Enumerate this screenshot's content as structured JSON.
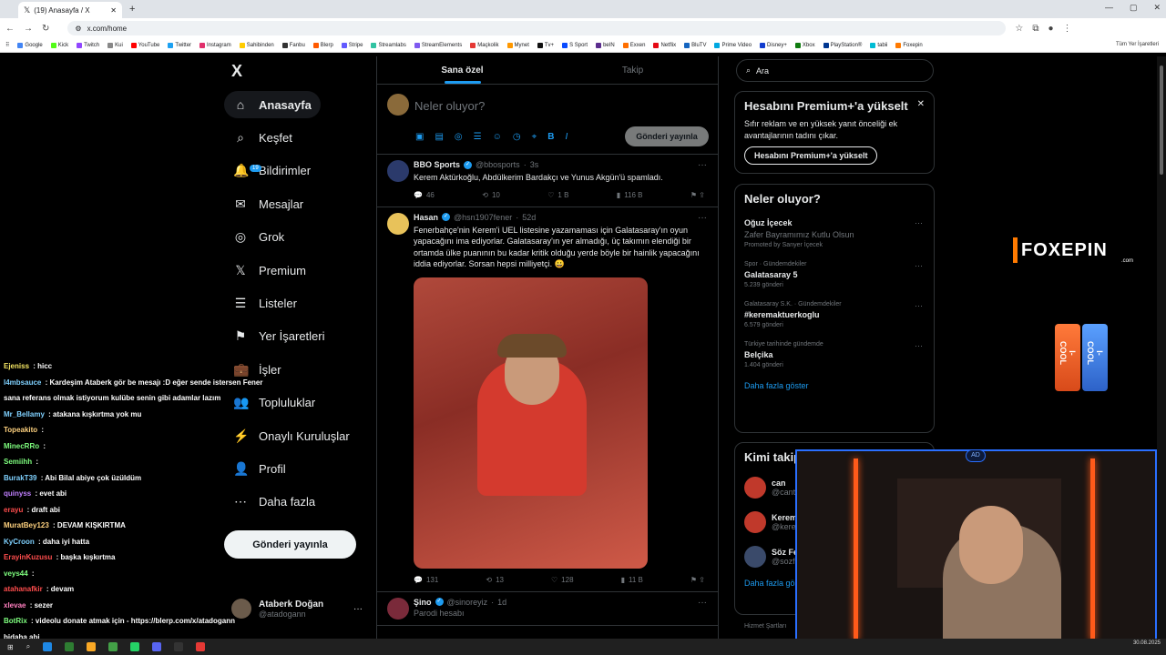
{
  "browser": {
    "tab_title": "(19) Anasayfa / X",
    "url": "x.com/home",
    "all_bookmarks": "Tüm Yer İşaretleri",
    "bookmarks": [
      "Google",
      "Kick",
      "Twitch",
      "Kui",
      "YouTube",
      "Twitter",
      "Instagram",
      "Sahibinden",
      "Fanbu",
      "Blerp",
      "Stripe",
      "Streamlabs",
      "StreamElements",
      "Maçkolik",
      "Mynet",
      "Tv+",
      "S Sport",
      "beIN",
      "Exxen",
      "Netflix",
      "BluTV",
      "Prime Video",
      "Disney+",
      "Xbox",
      "PlayStation®",
      "tabii",
      "Foxepin"
    ]
  },
  "nav": {
    "logo": "X",
    "items": [
      {
        "label": "Anasayfa",
        "icon": "home-icon"
      },
      {
        "label": "Keşfet",
        "icon": "search-icon"
      },
      {
        "label": "Bildirimler",
        "icon": "bell-icon",
        "badge": "19"
      },
      {
        "label": "Mesajlar",
        "icon": "mail-icon"
      },
      {
        "label": "Grok",
        "icon": "grok-icon"
      },
      {
        "label": "Premium",
        "icon": "x-premium-icon"
      },
      {
        "label": "Listeler",
        "icon": "list-icon"
      },
      {
        "label": "Yer İşaretleri",
        "icon": "bookmark-icon"
      },
      {
        "label": "İşler",
        "icon": "briefcase-icon"
      },
      {
        "label": "Topluluklar",
        "icon": "communities-icon"
      },
      {
        "label": "Onaylı Kuruluşlar",
        "icon": "lightning-icon"
      },
      {
        "label": "Profil",
        "icon": "profile-icon"
      },
      {
        "label": "Daha fazla",
        "icon": "more-circle-icon"
      }
    ],
    "post_button": "Gönderi yayınla",
    "account_name": "Ataberk Doğan",
    "account_handle": "@atadogann"
  },
  "timeline": {
    "tabs": [
      "Sana özel",
      "Takip"
    ],
    "compose_placeholder": "Neler oluyor?",
    "compose_button": "Gönderi yayınla",
    "tweets": [
      {
        "name": "BBO Sports",
        "handle": "@bbosports",
        "time": "3s",
        "text": "Kerem Aktürkoğlu, Abdülkerim Bardakçı ve Yunus Akgün'ü spamladı.",
        "replies": "46",
        "reposts": "10",
        "likes": "1 B",
        "views": "116 B"
      },
      {
        "name": "Hasan",
        "handle": "@hsn1907fener",
        "time": "52d",
        "text": "Fenerbahçe'nin Kerem'i UEL listesine yazamaması için Galatasaray'ın oyun yapacağını ima ediyorlar. Galatasaray'ın yer almadığı, üç takımın elendiği bir ortamda ülke puanının bu kadar kritik olduğu yerde böyle bir hainlik yapacağını iddia ediyorlar. Sorsan hepsi milliyetçi. 😀",
        "replies": "131",
        "reposts": "13",
        "likes": "128",
        "views": "11 B"
      },
      {
        "name": "Şino",
        "handle": "@sinoreyiz",
        "time": "1d",
        "parody": "Parodi hesabı"
      }
    ]
  },
  "right": {
    "search_placeholder": "Ara",
    "premium_title": "Hesabını Premium+'a yükselt",
    "premium_text": "Sıfır reklam ve en yüksek yanıt önceliği ek avantajlarının tadını çıkar.",
    "premium_button": "Hesabını Premium+'a yükselt",
    "trends_title": "Neler oluyor?",
    "trends": [
      {
        "context": "",
        "title": "Oğuz İçecek",
        "sub": "Zafer Bayramımız Kutlu Olsun",
        "promo": "Promoted by Sanyer İçecek"
      },
      {
        "context": "Spor · Gündemdekiler",
        "title": "Galatasaray 5",
        "sub": "5.239 gönderi"
      },
      {
        "context": "Galatasaray S.K. · Gündemdekiler",
        "title": "#keremaktuerkoglu",
        "sub": "6.579 gönderi"
      },
      {
        "context": "Türkiye tarihinde gündemde",
        "title": "Belçika",
        "sub": "1.404 gönderi"
      }
    ],
    "show_more": "Daha fazla göster",
    "who_title": "Kimi takip et",
    "who": [
      {
        "name": "can",
        "handle": "@cant"
      },
      {
        "name": "Kerem",
        "handle": "@kerem"
      },
      {
        "name": "Söz Fe",
        "handle": "@sozfl"
      }
    ],
    "show_more2": "Daha fazla göster",
    "footer": "Hizmet Şartları"
  },
  "overlay": {
    "brand": "FOXEPIN",
    "brand_sub": ".com",
    "can_text": "I-COOL"
  },
  "chat": [
    {
      "user": "Ejeniss",
      "text": "hicc",
      "color": "#f5e663"
    },
    {
      "user": "l4mbsauce",
      "text": "Kardeşim Ataberk gör be mesajı :D eğer sende istersen Fener",
      "color": "#7fd1ff"
    },
    {
      "user": "",
      "text": "sana referans olmak istiyorum kulübe senin gibi adamlar lazım",
      "color": "#ffffff"
    },
    {
      "user": "Mr_Bellamy",
      "text": "atakana kışkırtma yok mu",
      "color": "#7fd1ff"
    },
    {
      "user": "Topeakito",
      "text": "",
      "color": "#ffd27f"
    },
    {
      "user": "MinecRRo",
      "text": "",
      "color": "#7fff7f"
    },
    {
      "user": "Semiihh",
      "text": "",
      "color": "#7fff7f"
    },
    {
      "user": "BurakT39",
      "text": "Abi Bilal abiye çok üzüldüm",
      "color": "#7fd1ff"
    },
    {
      "user": "quinyss",
      "text": "evet abi",
      "color": "#c07fff"
    },
    {
      "user": "erayu",
      "text": "draft abi",
      "color": "#ff4d4d"
    },
    {
      "user": "MuratBey123",
      "text": "DEVAM KIŞKIRTMA",
      "color": "#ffd27f"
    },
    {
      "user": "KyCroon",
      "text": "daha iyi hatta",
      "color": "#7fd1ff"
    },
    {
      "user": "ErayinKuzusu",
      "text": "başka kışkırtma",
      "color": "#ff4d4d"
    },
    {
      "user": "veys44",
      "text": "",
      "color": "#7fff7f"
    },
    {
      "user": "atahanafkir",
      "text": "devam",
      "color": "#ff4d4d"
    },
    {
      "user": "xlevae",
      "text": "sezer",
      "color": "#ff7fbf"
    },
    {
      "user": "BotRix",
      "text": "videolu donate atmak için - https://blerp.com/x/atadogann",
      "color": "#7fff7f"
    },
    {
      "user": "",
      "text": "bidaha abi",
      "color": "#ffffff"
    }
  ],
  "taskbar": {
    "time": "30.08.2025"
  }
}
